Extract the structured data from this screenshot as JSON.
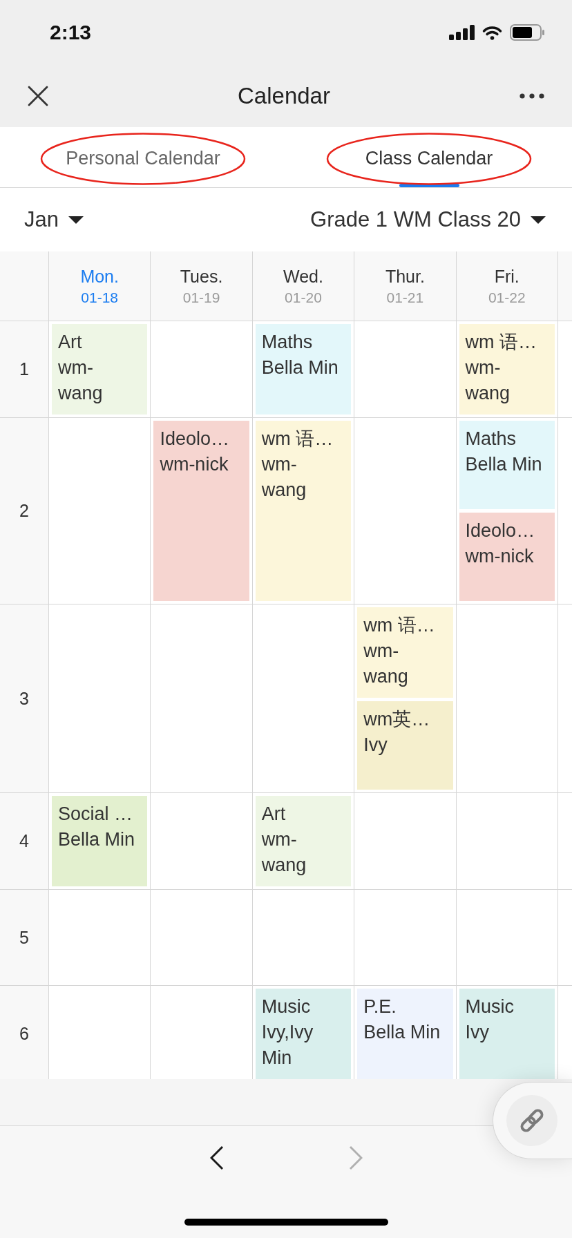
{
  "status_bar": {
    "time": "2:13"
  },
  "nav_bar": {
    "title": "Calendar"
  },
  "tabs": [
    {
      "label": "Personal Calendar",
      "selected": false,
      "circled": true
    },
    {
      "label": "Class Calendar",
      "selected": true,
      "circled": true
    }
  ],
  "filters": {
    "month": "Jan",
    "class": "Grade 1 WM Class 20"
  },
  "timetable": {
    "days": [
      {
        "name": "Mon.",
        "date": "01-18",
        "selected": true
      },
      {
        "name": "Tues.",
        "date": "01-19",
        "selected": false
      },
      {
        "name": "Wed.",
        "date": "01-20",
        "selected": false
      },
      {
        "name": "Thur.",
        "date": "01-21",
        "selected": false
      },
      {
        "name": "Fri.",
        "date": "01-22",
        "selected": false
      }
    ],
    "periods": [
      {
        "label": "1",
        "cells": [
          {
            "events": [
              {
                "title": "Art",
                "teacher": "wm-wang",
                "color": "#eef6e5"
              }
            ]
          },
          {},
          {
            "events": [
              {
                "title": "Maths",
                "teacher": "Bella Min",
                "color": "#e3f7fa"
              }
            ]
          },
          {},
          {
            "events": [
              {
                "title": "wm 语…",
                "teacher": "wm-wang",
                "color": "#fcf6da"
              }
            ]
          }
        ]
      },
      {
        "label": "2",
        "cells": [
          {},
          {
            "events": [
              {
                "title": "Ideolo…",
                "teacher": "wm-nick",
                "color": "#f6d5d0"
              }
            ]
          },
          {
            "events": [
              {
                "title": "wm 语…",
                "teacher": "wm-wang",
                "color": "#fcf6da"
              }
            ]
          },
          {},
          {
            "events": [
              {
                "title": "Maths",
                "teacher": "Bella Min",
                "color": "#e3f7fa"
              },
              {
                "title": "Ideolo…",
                "teacher": "wm-nick",
                "color": "#f6d5d0"
              }
            ]
          }
        ]
      },
      {
        "label": "3",
        "cells": [
          {},
          {},
          {},
          {
            "events": [
              {
                "title": "wm 语…",
                "teacher": "wm-wang",
                "color": "#fcf6da"
              },
              {
                "title": "wm英…",
                "teacher": "Ivy",
                "color": "#f5efcd"
              }
            ]
          },
          {}
        ]
      },
      {
        "label": "4",
        "cells": [
          {
            "events": [
              {
                "title": "Social …",
                "teacher": "Bella Min",
                "color": "#e3f0cf"
              }
            ]
          },
          {},
          {
            "events": [
              {
                "title": "Art",
                "teacher": "wm-wang",
                "color": "#eef6e5"
              }
            ]
          },
          {},
          {}
        ]
      },
      {
        "label": "5",
        "cells": [
          {},
          {},
          {},
          {},
          {}
        ]
      },
      {
        "label": "6",
        "cells": [
          {},
          {},
          {
            "events": [
              {
                "title": "Music",
                "teacher": "Ivy,Ivy Min",
                "color": "#d9efed"
              }
            ]
          },
          {
            "events": [
              {
                "title": "P.E.",
                "teacher": "Bella Min",
                "color": "#eef3fd"
              }
            ]
          },
          {
            "events": [
              {
                "title": "Music",
                "teacher": "Ivy",
                "color": "#d9efed"
              }
            ]
          }
        ]
      }
    ]
  },
  "pager": {
    "previous": {
      "disabled": false
    },
    "next": {
      "disabled": true
    }
  }
}
